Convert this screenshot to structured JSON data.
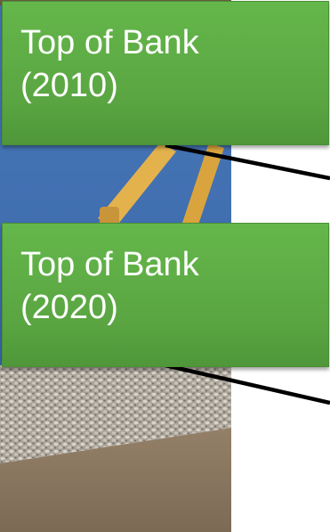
{
  "labels": [
    {
      "line1": "Top of Bank",
      "line2": "(2010)"
    },
    {
      "line1": "Top of Bank",
      "line2": "(2020)"
    }
  ],
  "colors": {
    "label_fill": "#5aa542",
    "label_text": "#ffffff",
    "leader_line": "#000000",
    "sky": "#3d6fb3",
    "excavator_arm": "#e0b04a",
    "riprap": "#b8b2a8",
    "water": "#8a7762"
  }
}
